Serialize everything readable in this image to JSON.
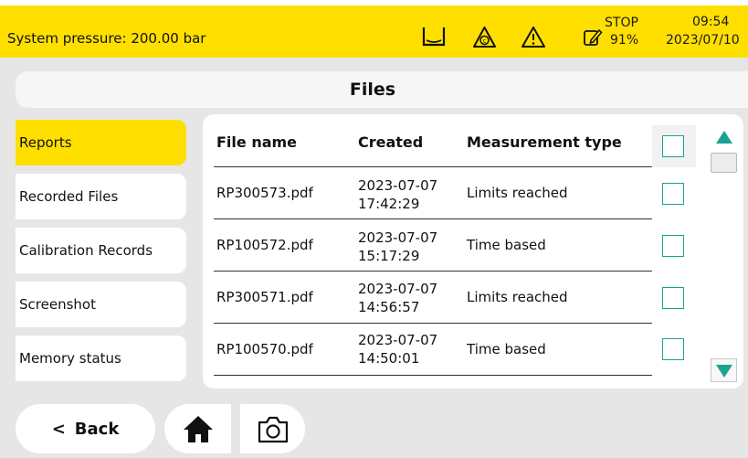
{
  "status": {
    "pressure": "System pressure: 200.00 bar",
    "stop_label": "STOP",
    "stop_percent": "91%",
    "time": "09:54",
    "date": "2023/07/10",
    "icons": [
      "tank-icon",
      "calibration-warning-icon",
      "warning-icon",
      "edit-icon"
    ],
    "accent_color": "#ffdf00"
  },
  "title": "Files",
  "sidebar": {
    "items": [
      {
        "label": "Reports",
        "active": true
      },
      {
        "label": "Recorded Files"
      },
      {
        "label": "Calibration Records"
      },
      {
        "label": "Screenshot"
      },
      {
        "label": "Memory status"
      }
    ]
  },
  "table": {
    "columns": [
      "File name",
      "Created",
      "Measurement type"
    ],
    "rows": [
      {
        "file": "RP300573.pdf",
        "date": "2023-07-07",
        "time": "17:42:29",
        "type": "Limits reached"
      },
      {
        "file": "RP100572.pdf",
        "date": "2023-07-07",
        "time": "15:17:29",
        "type": "Time based"
      },
      {
        "file": "RP300571.pdf",
        "date": "2023-07-07",
        "time": "14:56:57",
        "type": "Limits reached"
      },
      {
        "file": "RP100570.pdf",
        "date": "2023-07-07",
        "time": "14:50:01",
        "type": "Time based"
      }
    ],
    "checkbox_color": "#1aa391"
  },
  "footer": {
    "back_label": "Back",
    "back_chevron": "<"
  }
}
